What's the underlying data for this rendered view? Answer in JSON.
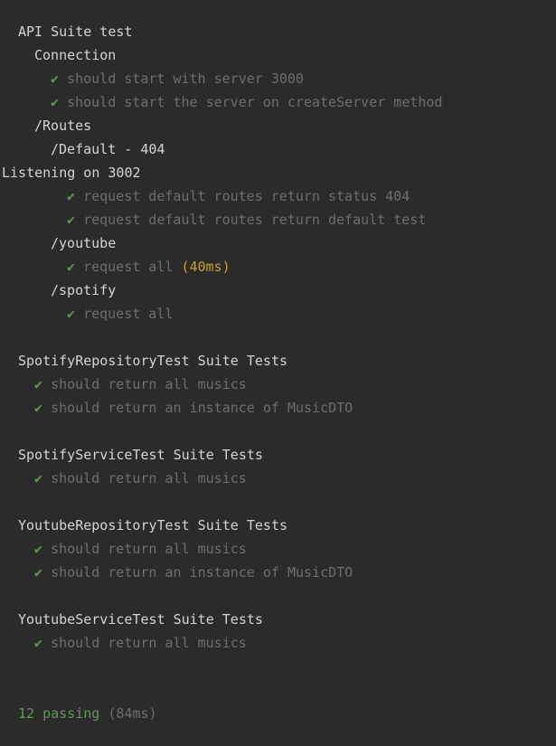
{
  "colors": {
    "background": "#2b2b2b",
    "heading": "#d4d4d4",
    "check": "#629755",
    "passed_test": "#6e6e6e",
    "slow_duration": "#c9a227",
    "passing_summary": "#629755"
  },
  "check_glyph": "✔",
  "lines": [
    {
      "type": "suite",
      "indent": 1,
      "text": "API Suite test"
    },
    {
      "type": "suite",
      "indent": 2,
      "text": "Connection"
    },
    {
      "type": "test",
      "indent": 3,
      "text": "should start with server 3000"
    },
    {
      "type": "test",
      "indent": 3,
      "text": "should start the server on createServer method"
    },
    {
      "type": "suite",
      "indent": 2,
      "text": "/Routes"
    },
    {
      "type": "suite",
      "indent": 3,
      "text": "/Default - 404"
    },
    {
      "type": "log",
      "indent": 0,
      "text": "Listening on 3002"
    },
    {
      "type": "test",
      "indent": 4,
      "text": "request default routes return status 404"
    },
    {
      "type": "test",
      "indent": 4,
      "text": "request default routes return default test"
    },
    {
      "type": "suite",
      "indent": 3,
      "text": "/youtube"
    },
    {
      "type": "test",
      "indent": 4,
      "text": "request all",
      "duration": "(40ms)"
    },
    {
      "type": "suite",
      "indent": 3,
      "text": "/spotify"
    },
    {
      "type": "test",
      "indent": 4,
      "text": "request all"
    },
    {
      "type": "blank"
    },
    {
      "type": "suite",
      "indent": 1,
      "text": "SpotifyRepositoryTest Suite Tests"
    },
    {
      "type": "test",
      "indent": 2,
      "text": "should return all musics"
    },
    {
      "type": "test",
      "indent": 2,
      "text": "should return an instance of MusicDTO"
    },
    {
      "type": "blank"
    },
    {
      "type": "suite",
      "indent": 1,
      "text": "SpotifyServiceTest Suite Tests"
    },
    {
      "type": "test",
      "indent": 2,
      "text": "should return all musics"
    },
    {
      "type": "blank"
    },
    {
      "type": "suite",
      "indent": 1,
      "text": "YoutubeRepositoryTest Suite Tests"
    },
    {
      "type": "test",
      "indent": 2,
      "text": "should return all musics"
    },
    {
      "type": "test",
      "indent": 2,
      "text": "should return an instance of MusicDTO"
    },
    {
      "type": "blank"
    },
    {
      "type": "suite",
      "indent": 1,
      "text": "YoutubeServiceTest Suite Tests"
    },
    {
      "type": "test",
      "indent": 2,
      "text": "should return all musics"
    },
    {
      "type": "blank"
    },
    {
      "type": "blank"
    },
    {
      "type": "summary",
      "indent": 1,
      "count_text": "12 passing",
      "time_text": "(84ms)"
    }
  ]
}
